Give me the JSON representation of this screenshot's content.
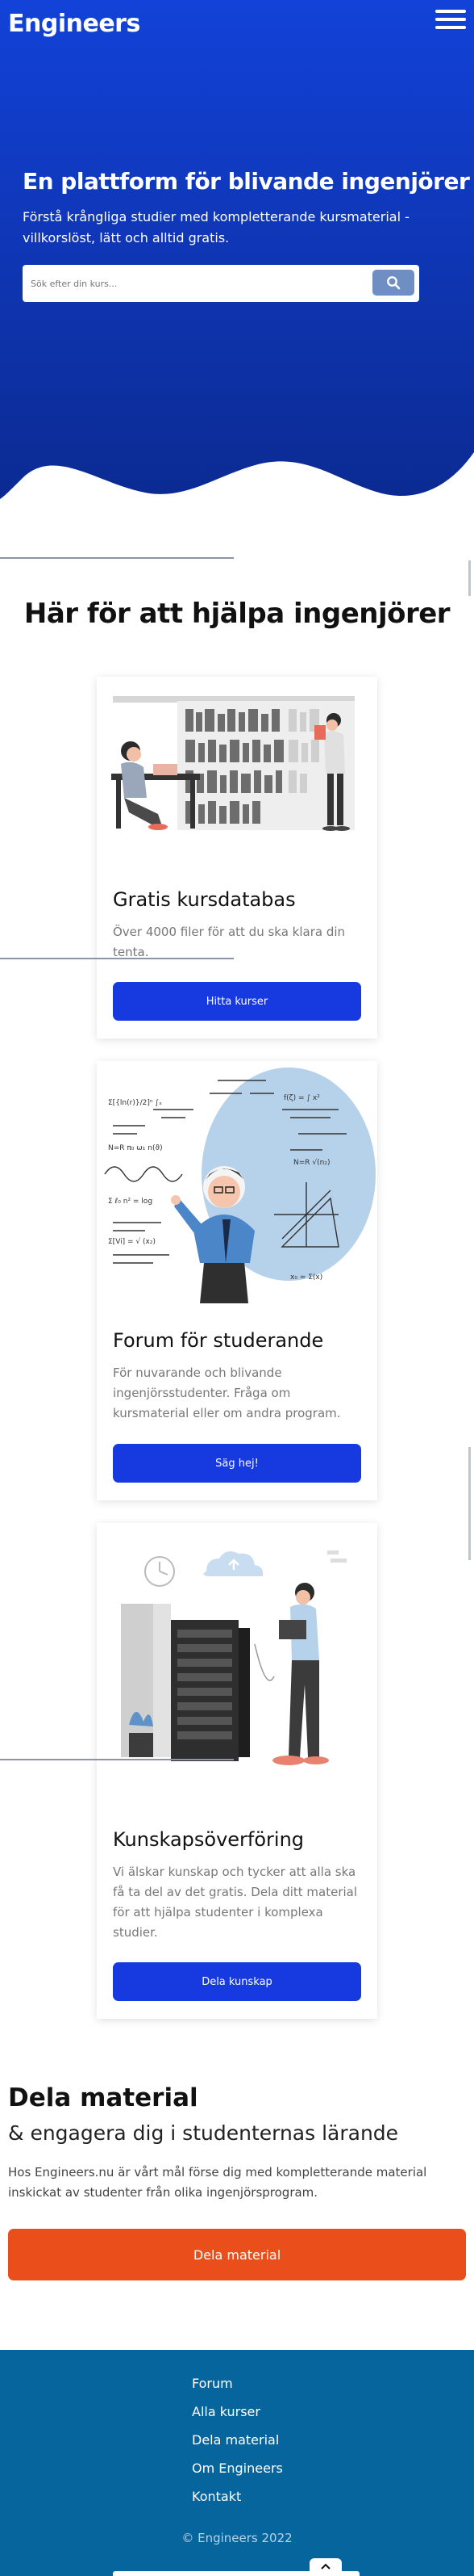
{
  "header": {
    "brand": "Engineers",
    "menu_icon": "hamburger-menu-icon"
  },
  "hero": {
    "title": "En plattform för blivande ingenjörer",
    "subtitle": "Förstå krångliga studier med kompletterande kursmaterial - villkorslöst, lätt och alltid gratis.",
    "search_placeholder": "Sök efter din kurs...",
    "search_icon": "search-icon",
    "gradient_top": "#1242d8",
    "gradient_bottom": "#0c2a94"
  },
  "section": {
    "title": "Här för att hjälpa ingenjörer"
  },
  "cards": [
    {
      "title": "Gratis kursdatabas",
      "text": "Över 4000 filer för att du ska klara din tenta.",
      "button": "Hitta kurser",
      "illustration": "students-library-illustration"
    },
    {
      "title": "Forum för studerande",
      "text": "För nuvarande och blivande ingenjörsstudenter. Fråga om kursmaterial eller om andra program.",
      "button": "Säg hej!",
      "illustration": "teacher-formulas-illustration"
    },
    {
      "title": "Kunskapsöverföring",
      "text": "Vi älskar kunskap och tycker att alla ska få ta del av det gratis. Dela ditt material för att hjälpa studenter i komplexa studier.",
      "button": "Dela kunskap",
      "illustration": "server-cloud-illustration"
    }
  ],
  "share": {
    "title": "Dela material",
    "subtitle": "& engagera dig i studenternas lärande",
    "text": "Hos Engineers.nu är vårt mål förse dig med kompletterande material inskickat av studenter från olika ingenjörsprogram.",
    "button": "Dela material",
    "accent": "#e94e1b"
  },
  "footer": {
    "links": [
      "Forum",
      "Alla kurser",
      "Dela material",
      "Om Engineers",
      "Kontakt"
    ],
    "copyright": "© Engineers 2022",
    "background": "#06659d"
  },
  "colors": {
    "primary_button": "#1739e0"
  }
}
